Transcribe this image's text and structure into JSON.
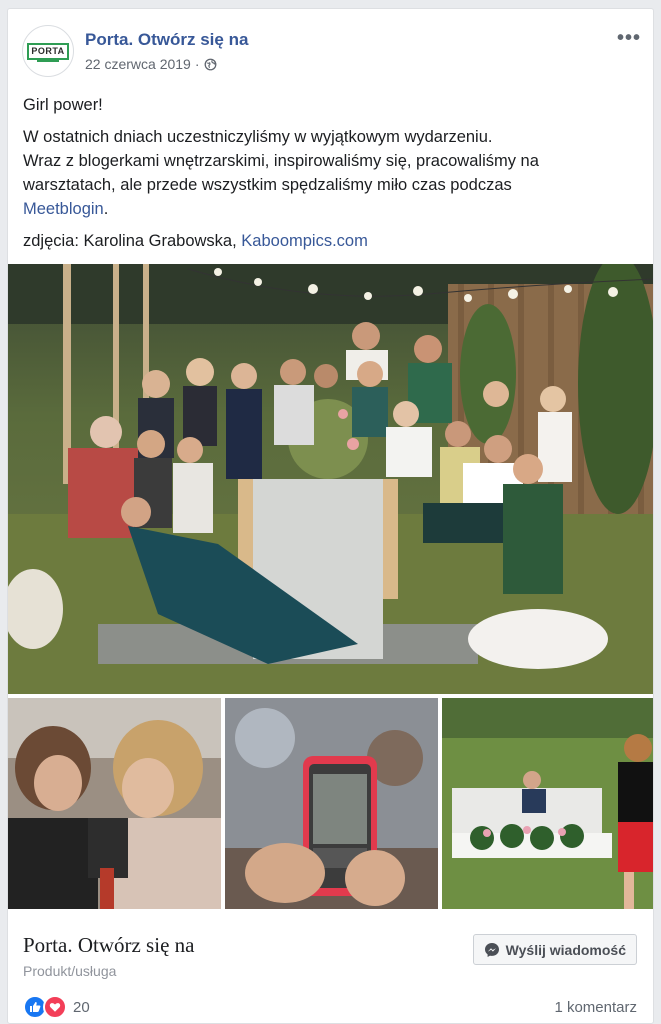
{
  "post": {
    "page_name": "Porta. Otwórz się na",
    "logo_text": "PORTA",
    "date": "22 czerwca 2019",
    "separator": "·",
    "privacy_icon": "globe-icon",
    "more_icon": "more-options-icon",
    "more_label": "•••",
    "line1": "Girl power!",
    "paragraph_lines": [
      "W ostatnich dniach uczestniczyliśmy w wyjątkowym wydarzeniu.",
      "Wraz z blogerkami wnętrzarskimi, inspirowaliśmy się, pracowaliśmy na",
      "warsztatach, ale przede wszystkim spędzaliśmy miło czas podczas"
    ],
    "link_meetblogin": "Meetblogin",
    "link_suffix": ".",
    "credit_prefix": "zdjęcia: Karolina Grabowska,",
    "credit_link": "Kaboompics.com"
  },
  "footer": {
    "title": "Porta. Otwórz się na",
    "subtitle": "Produkt/usługa",
    "message_button": "Wyślij wiadomość",
    "messenger_icon": "messenger-icon",
    "reaction_count": "20",
    "comments": "1 komentarz"
  },
  "colors": {
    "link": "#385898",
    "like": "#1877f2",
    "love": "#f33e58",
    "brand_green": "#2f9d54"
  }
}
